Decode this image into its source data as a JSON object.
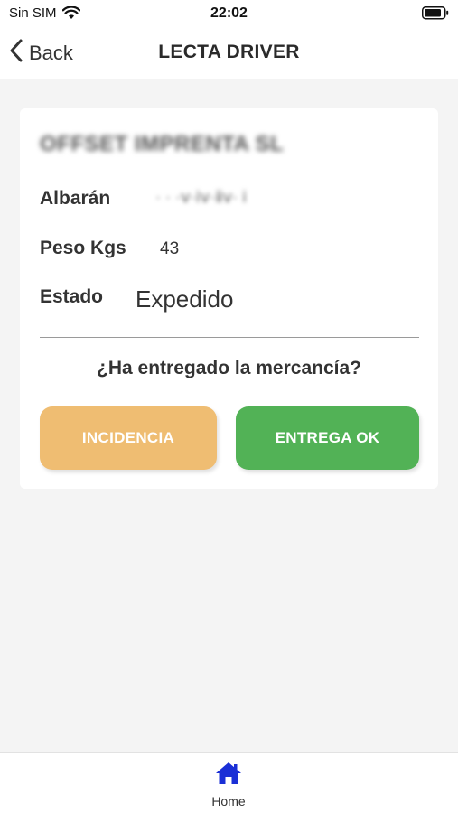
{
  "status_bar": {
    "carrier": "Sin SIM",
    "time": "22:02",
    "wifi_icon": "wifi-icon",
    "battery_icon": "battery-icon"
  },
  "nav": {
    "back_label": "Back",
    "back_icon": "chevron-left-icon",
    "title": "LECTA DRIVER"
  },
  "delivery": {
    "company_name": "OFFSET IMPRENTA SL",
    "albaran_label": "Albarán",
    "albaran_value": "· ·  ·ⅴ·ⅰⅴ·ⅱⅴ· ⅰ",
    "peso_label": "Peso Kgs",
    "peso_value": "43",
    "estado_label": "Estado",
    "estado_value": "Expedido"
  },
  "confirm": {
    "question": "¿Ha entregado la mercancía?",
    "incidencia_label": "INCIDENCIA",
    "ok_label": "ENTREGA OK"
  },
  "tab_bar": {
    "home_label": "Home",
    "home_icon": "home-icon"
  },
  "colors": {
    "accent_home": "#1a2fd6",
    "incidencia": "#efbd72",
    "entrega_ok": "#52b256",
    "background": "#f4f4f4"
  }
}
